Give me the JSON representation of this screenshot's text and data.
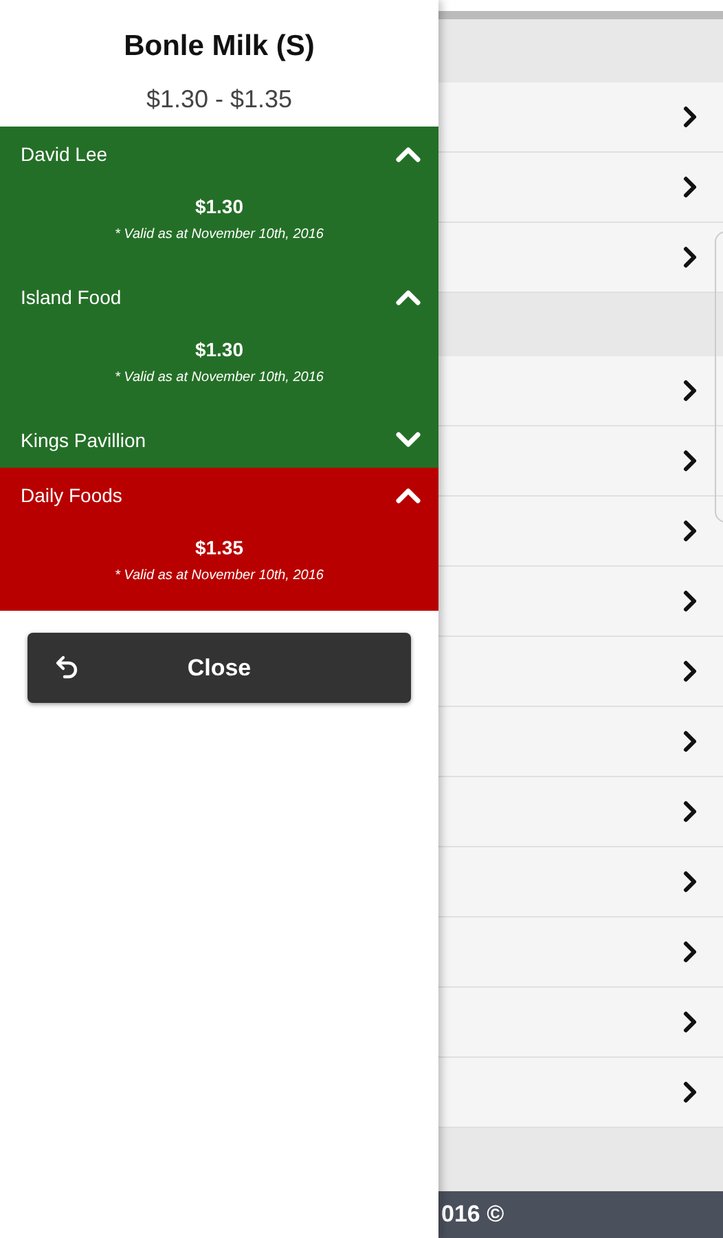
{
  "product": {
    "title": "Bonle Milk (S)",
    "price_range": "$1.30 - $1.35"
  },
  "stores": [
    {
      "name": "David Lee",
      "expanded": true,
      "price": "$1.30",
      "valid_note": "* Valid as at November 10th, 2016",
      "color": "#246f27"
    },
    {
      "name": "Island Food",
      "expanded": true,
      "price": "$1.30",
      "valid_note": "* Valid as at November 10th, 2016",
      "color": "#246f27"
    },
    {
      "name": "Kings Pavillion",
      "expanded": false,
      "color": "#246f27"
    },
    {
      "name": "Daily Foods",
      "expanded": true,
      "price": "$1.35",
      "valid_note": "* Valid as at November 10th, 2016",
      "color": "#b80000"
    }
  ],
  "close_button": {
    "label": "Close"
  },
  "background_list": {
    "rows": [
      {
        "kind": "header"
      },
      {
        "kind": "item"
      },
      {
        "kind": "item"
      },
      {
        "kind": "item"
      },
      {
        "kind": "header"
      },
      {
        "kind": "item"
      },
      {
        "kind": "item"
      },
      {
        "kind": "item"
      },
      {
        "kind": "item"
      },
      {
        "kind": "item"
      },
      {
        "kind": "item"
      },
      {
        "kind": "item"
      },
      {
        "kind": "item"
      },
      {
        "kind": "item"
      },
      {
        "kind": "item"
      },
      {
        "kind": "item"
      },
      {
        "kind": "header"
      }
    ]
  },
  "footer": {
    "text": "016 ©"
  }
}
